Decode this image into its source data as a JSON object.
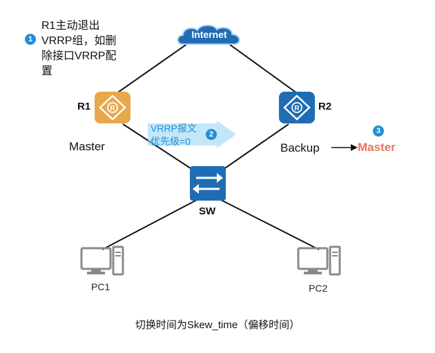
{
  "steps": {
    "step1": {
      "number": "1",
      "lines": [
        "R1主动退出",
        "VRRP组，如删",
        "除接口VRRP配",
        "置"
      ]
    },
    "step2": {
      "number": "2",
      "lines": [
        "VRRP报文",
        "优先级=0"
      ]
    },
    "step3": {
      "number": "3",
      "label": "Master"
    }
  },
  "nodes": {
    "internet": "Internet",
    "r1": {
      "name": "R1",
      "role": "Master"
    },
    "r2": {
      "name": "R2",
      "role": "Backup"
    },
    "sw": "SW",
    "pc1": "PC1",
    "pc2": "PC2"
  },
  "caption": "切换时间为Skew_time（偏移时间）",
  "colors": {
    "router_r1": "#e8a84a",
    "router_r2": "#1f6db5",
    "switch": "#1f6db5",
    "internet_cloud": "#1f6db5",
    "badge": "#1e8fd8",
    "packet_arrow": "#8fd3f4",
    "new_master": "#e8745f",
    "pc": "#8a8a8a"
  }
}
